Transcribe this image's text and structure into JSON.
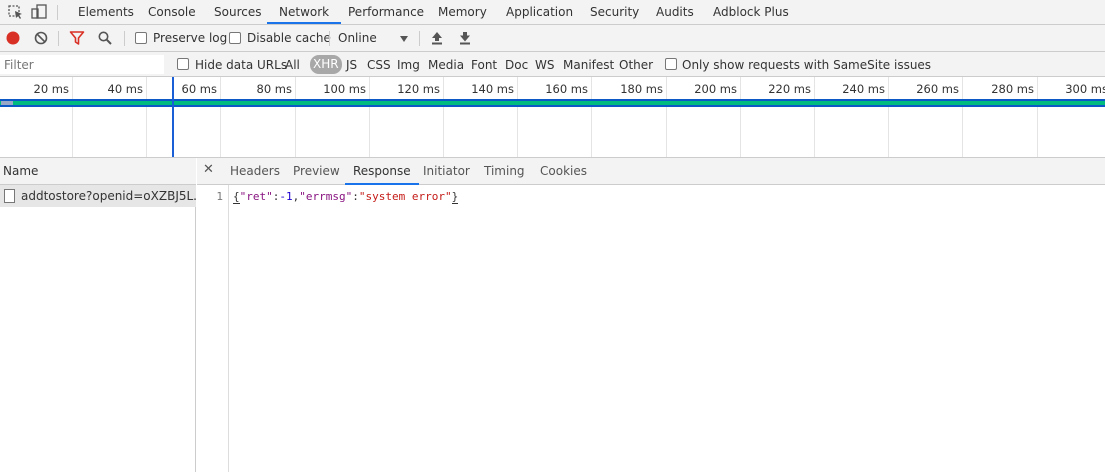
{
  "topbar": {
    "tabs": [
      "Elements",
      "Console",
      "Sources",
      "Network",
      "Performance",
      "Memory",
      "Application",
      "Security",
      "Audits",
      "Adblock Plus"
    ],
    "active_tab": "Network"
  },
  "toolbar": {
    "preserve_log_label": "Preserve log",
    "disable_cache_label": "Disable cache",
    "throttling_value": "Online"
  },
  "filterbar": {
    "filter_placeholder": "Filter",
    "hide_data_urls_label": "Hide data URLs",
    "types": [
      "All",
      "XHR",
      "JS",
      "CSS",
      "Img",
      "Media",
      "Font",
      "Doc",
      "WS",
      "Manifest",
      "Other"
    ],
    "selected_type": "XHR",
    "samesite_label": "Only show requests with SameSite issues"
  },
  "timeline": {
    "ticks": [
      "20 ms",
      "40 ms",
      "60 ms",
      "80 ms",
      "100 ms",
      "120 ms",
      "140 ms",
      "160 ms",
      "180 ms",
      "200 ms",
      "220 ms",
      "240 ms",
      "260 ms",
      "280 ms",
      "300 ms"
    ]
  },
  "requests": {
    "column_name": "Name",
    "rows": [
      {
        "name": "addtostore?openid=oXZBJ5L..."
      }
    ]
  },
  "details": {
    "tabs": [
      "Headers",
      "Preview",
      "Response",
      "Initiator",
      "Timing",
      "Cookies"
    ],
    "active_tab": "Response",
    "response": {
      "line_number": "1",
      "key1": "\"ret\"",
      "val1": "-1",
      "key2": "\"errmsg\"",
      "val2": "\"system error\""
    }
  },
  "colors": {
    "accent": "#1a73e8",
    "record": "#d93025",
    "filter_icon": "#d93025",
    "timeline_bar": "#00bb80",
    "timeline_border": "#0b58c6"
  }
}
